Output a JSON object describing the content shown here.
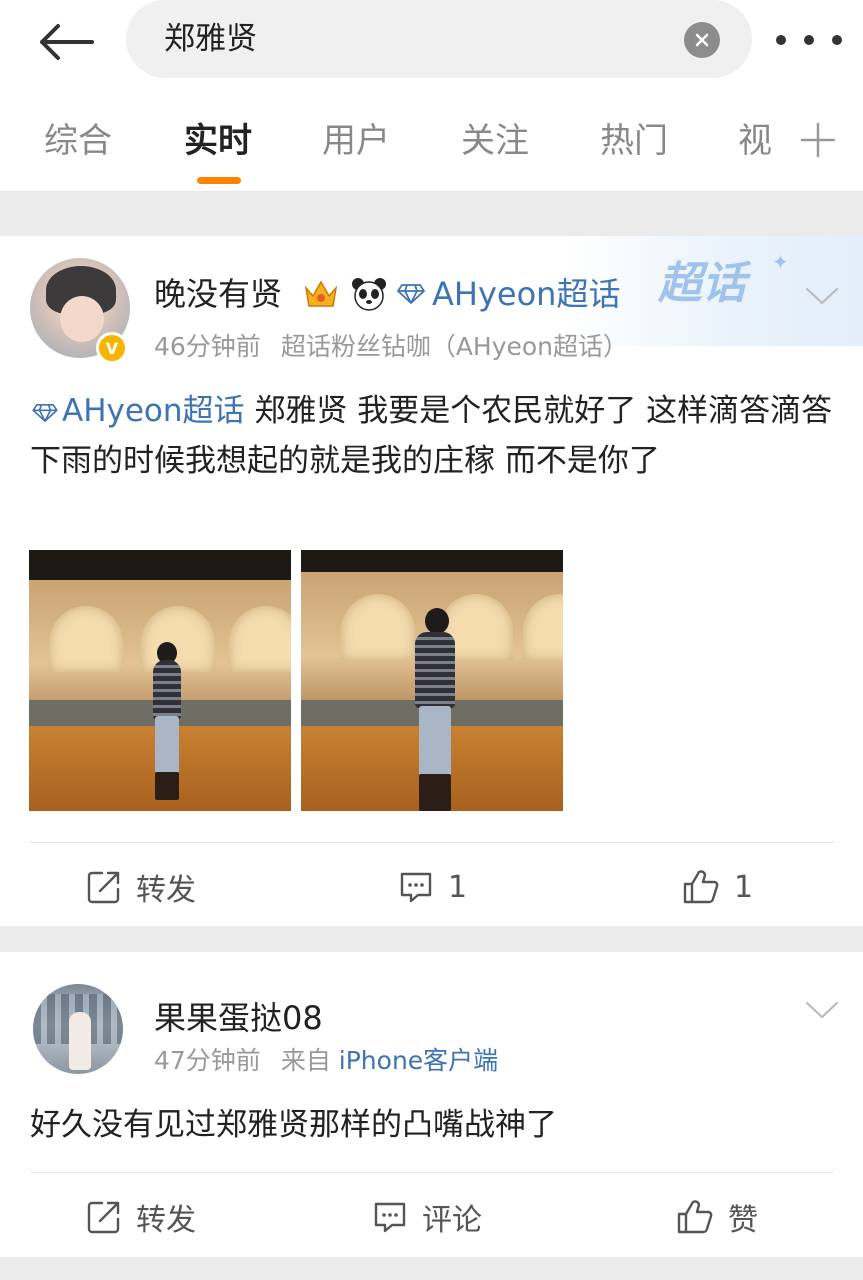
{
  "search": {
    "query": "郑雅贤"
  },
  "tabs": [
    {
      "label": "综合",
      "active": false
    },
    {
      "label": "实时",
      "active": true
    },
    {
      "label": "用户",
      "active": false
    },
    {
      "label": "关注",
      "active": false
    },
    {
      "label": "热门",
      "active": false
    },
    {
      "label": "视",
      "active": false
    }
  ],
  "accent_color": "#ff8200",
  "link_color": "#3e74b3",
  "posts": [
    {
      "username": "晚没有贤",
      "badges": [
        "crown-icon",
        "panda-icon"
      ],
      "topic_link": "AHyeon超话",
      "supertopic_watermark": "超话",
      "time": "46分钟前",
      "source": "超话粉丝钻咖（AHyeon超话）",
      "text_topic": "AHyeon超话",
      "text": " 郑雅贤 我要是个农民就好了 这样滴答滴答下雨的时候我想起的就是我的庄稼 而不是你了",
      "verified": true,
      "repost_label": "转发",
      "comment_count": "1",
      "like_count": "1"
    },
    {
      "username": "果果蛋挞08",
      "time": "47分钟前",
      "source_prefix": "来自",
      "source": "iPhone客户端",
      "text": "好久没有见过郑雅贤那样的凸嘴战神了",
      "repost_label": "转发",
      "comment_label": "评论",
      "like_label": "赞"
    }
  ]
}
